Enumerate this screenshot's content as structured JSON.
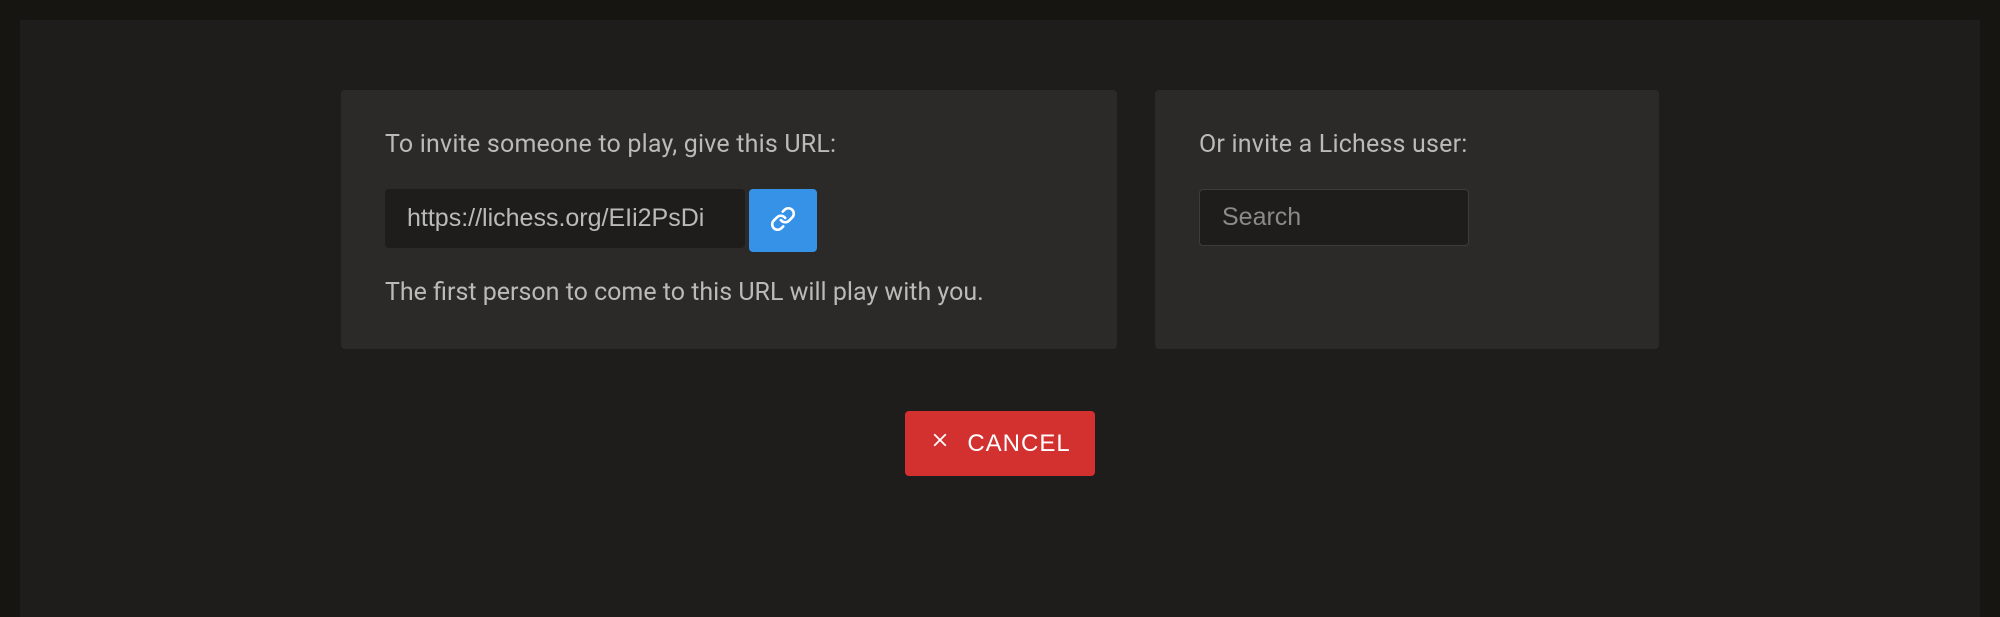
{
  "invite": {
    "heading": "To invite someone to play, give this URL:",
    "url": "https://lichess.org/EIi2PsDi",
    "help_text": "The first person to come to this URL will play with you."
  },
  "user_invite": {
    "heading": "Or invite a Lichess user:",
    "search_placeholder": "Search"
  },
  "actions": {
    "cancel_label": "CANCEL"
  }
}
